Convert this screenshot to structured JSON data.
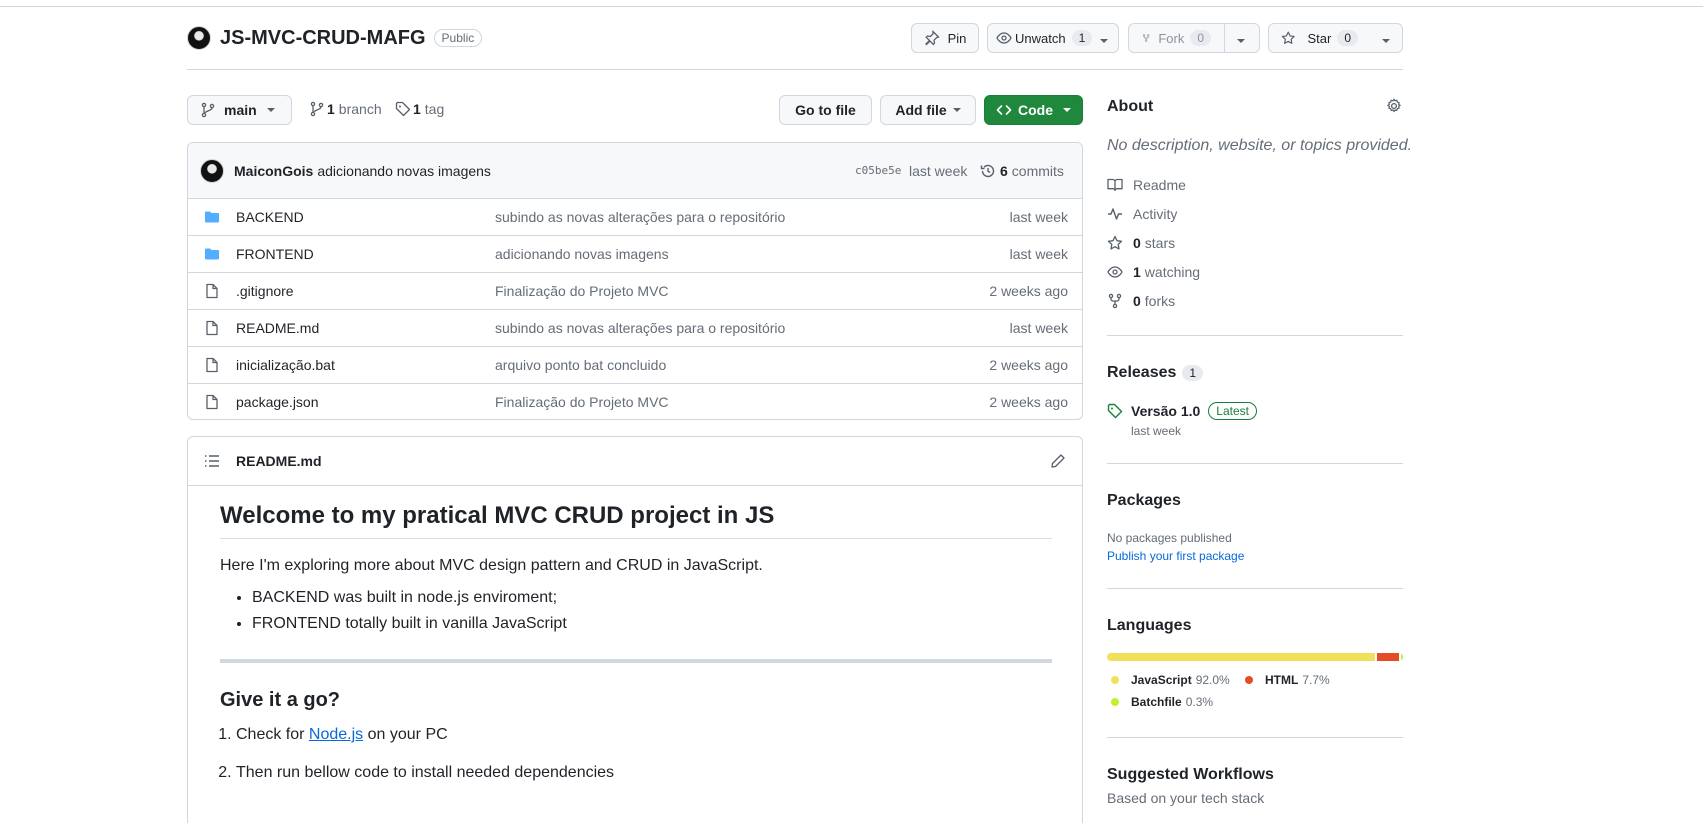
{
  "repo": {
    "name": "JS-MVC-CRUD-MAFG",
    "visibility": "Public",
    "actions": {
      "pin_label": "Pin",
      "unwatch_label": "Unwatch",
      "watch_count": "1",
      "fork_label": "Fork",
      "fork_count": "0",
      "star_label": "Star",
      "star_count": "0"
    }
  },
  "toolbar": {
    "branch_name": "main",
    "branch_count": "1",
    "branch_word": "branch",
    "tag_count": "1",
    "tag_word": "tag",
    "go_to_file": "Go to file",
    "add_file": "Add file",
    "code": "Code"
  },
  "commit": {
    "author": "MaiconGois",
    "message": "adicionando novas imagens",
    "sha": "c05be5e",
    "time": "last week",
    "count": "6",
    "count_word": "commits"
  },
  "files": [
    {
      "type": "folder",
      "name": "BACKEND",
      "message": "subindo as novas alterações para o repositório",
      "date": "last week"
    },
    {
      "type": "folder",
      "name": "FRONTEND",
      "message": "adicionando novas imagens",
      "date": "last week"
    },
    {
      "type": "file",
      "name": ".gitignore",
      "message": "Finalização do Projeto MVC",
      "date": "2 weeks ago"
    },
    {
      "type": "file",
      "name": "README.md",
      "message": "subindo as novas alterações para o repositório",
      "date": "last week"
    },
    {
      "type": "file",
      "name": "inicialização.bat",
      "message": "arquivo ponto bat concluido",
      "date": "2 weeks ago"
    },
    {
      "type": "file",
      "name": "package.json",
      "message": "Finalização do Projeto MVC",
      "date": "2 weeks ago"
    }
  ],
  "readme": {
    "filename": "README.md",
    "title": "Welcome to my pratical MVC CRUD project in JS",
    "intro": "Here I'm exploring more about MVC design pattern and CRUD in JavaScript.",
    "bullets": [
      "BACKEND was built in node.js enviroment;",
      "FRONTEND totally built in vanilla JavaScript"
    ],
    "section2_title": "Give it a go?",
    "step1_prefix": "Check for",
    "step1_link": "Node.js",
    "step1_suffix": "on your PC",
    "step2": "Then run bellow code to install needed dependencies"
  },
  "about": {
    "heading": "About",
    "description": "No description, website, or topics provided.",
    "readme": "Readme",
    "activity": "Activity",
    "stars_count": "0",
    "stars_word": "stars",
    "watching_count": "1",
    "watching_word": "watching",
    "forks_count": "0",
    "forks_word": "forks"
  },
  "releases": {
    "heading": "Releases",
    "count": "1",
    "name": "Versão 1.0",
    "badge": "Latest",
    "date": "last week"
  },
  "packages": {
    "heading": "Packages",
    "none": "No packages published",
    "link": "Publish your first package"
  },
  "languages": {
    "heading": "Languages",
    "items": [
      {
        "name": "JavaScript",
        "percent": "92.0%",
        "value": 92.0,
        "color": "#f1e05a"
      },
      {
        "name": "HTML",
        "percent": "7.7%",
        "value": 7.7,
        "color": "#e34c26"
      },
      {
        "name": "Batchfile",
        "percent": "0.3%",
        "value": 0.3,
        "color": "#c1f12e"
      }
    ]
  },
  "workflows": {
    "heading": "Suggested Workflows",
    "sub": "Based on your tech stack"
  },
  "colors": {
    "accent_green": "#1f883d",
    "link_blue": "#0969da",
    "folder_blue": "#54aeff"
  }
}
